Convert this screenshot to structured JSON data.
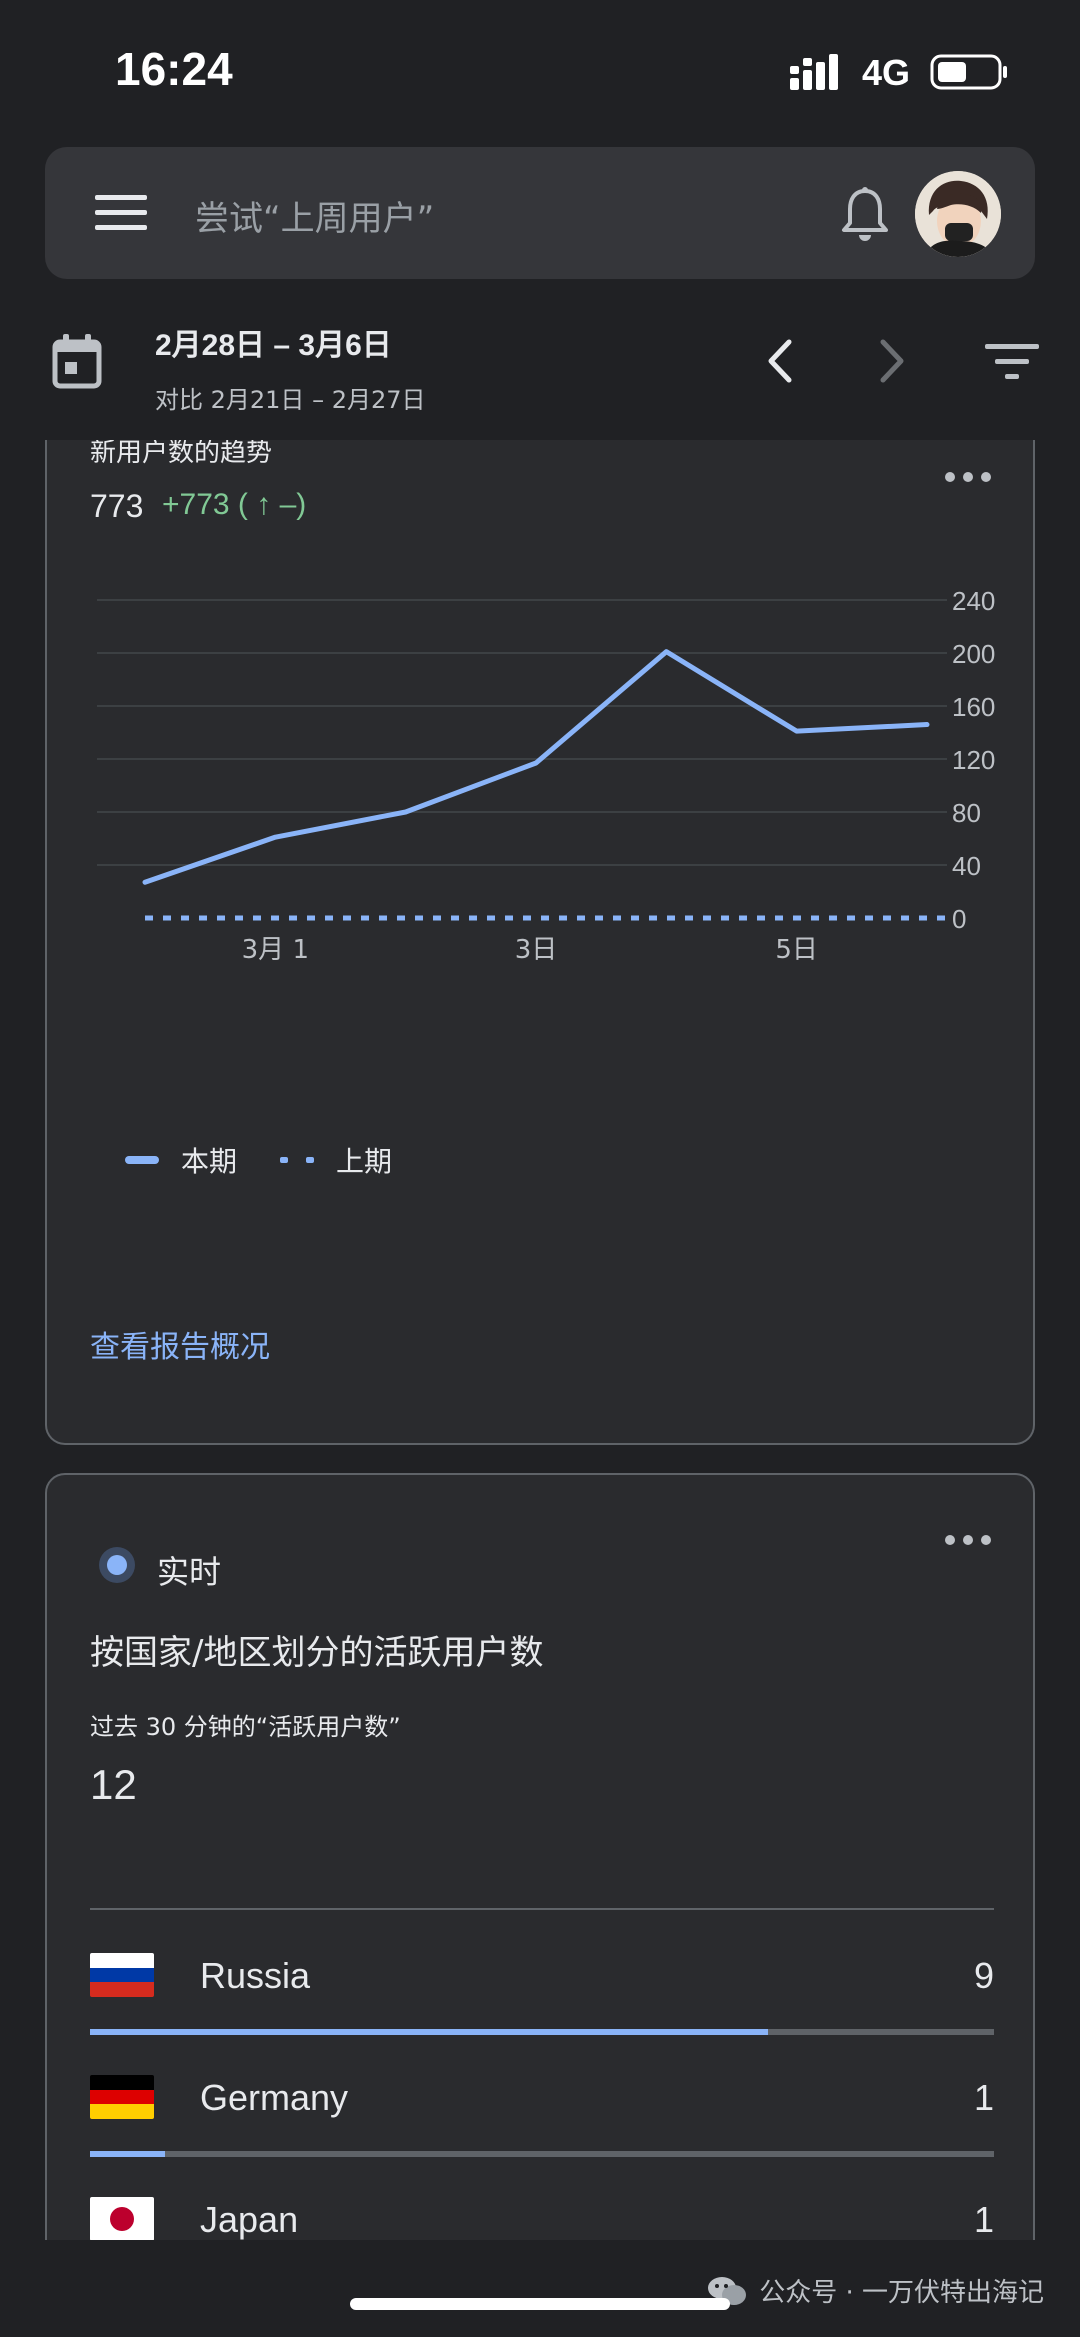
{
  "status_bar": {
    "time": "16:24",
    "network": "4G"
  },
  "search": {
    "placeholder": "尝试“上周用户”"
  },
  "date_range": {
    "current": "2月28日 – 3月6日",
    "compare": "对比 2月21日 – 2月27日"
  },
  "trend_card": {
    "title": "新用户数的趋势",
    "value": "773",
    "delta": "+773 ( ↑ –)",
    "legend_current": "本期",
    "legend_previous": "上期",
    "link": "查看报告概况"
  },
  "chart_data": {
    "type": "line",
    "x": [
      "2月28日",
      "3月1日",
      "3月2日",
      "3月3日",
      "3月4日",
      "3月5日",
      "3月6日"
    ],
    "x_tick_labels": [
      "3月 1",
      "3日",
      "5日"
    ],
    "y_ticks": [
      "0",
      "40",
      "80",
      "120",
      "160",
      "200",
      "240"
    ],
    "ylim": [
      0,
      240
    ],
    "series": [
      {
        "name": "本期",
        "values": [
          27,
          61,
          80,
          117,
          201,
          141,
          146
        ],
        "style": "solid",
        "color": "#8ab4f8"
      },
      {
        "name": "上期",
        "values": [
          0,
          0,
          0,
          0,
          0,
          0,
          0
        ],
        "style": "dashed",
        "color": "#8ab4f8"
      }
    ],
    "grid": true,
    "legend_placement": "bottom-left"
  },
  "realtime_card": {
    "label": "实时",
    "title": "按国家/地区划分的活跃用户数",
    "subtitle": "过去 30 分钟的“活跃用户数”",
    "count": "12",
    "countries": [
      {
        "name": "Russia",
        "count": "9",
        "share": 0.75,
        "flag": [
          "#ffffff",
          "#0039a6",
          "#d52b1e"
        ]
      },
      {
        "name": "Germany",
        "count": "1",
        "share": 0.0833,
        "flag": [
          "#000000",
          "#dd0000",
          "#ffce00"
        ]
      },
      {
        "name": "Japan",
        "count": "1",
        "share": 0.0833,
        "flag": [
          "#ffffff"
        ]
      }
    ]
  },
  "watermark": {
    "text": "公众号 · 一万伏特出海记"
  },
  "colors": {
    "background": "#202124",
    "card": "#2a2b2e",
    "accent": "#8ab4f8",
    "positive": "#81c995"
  }
}
